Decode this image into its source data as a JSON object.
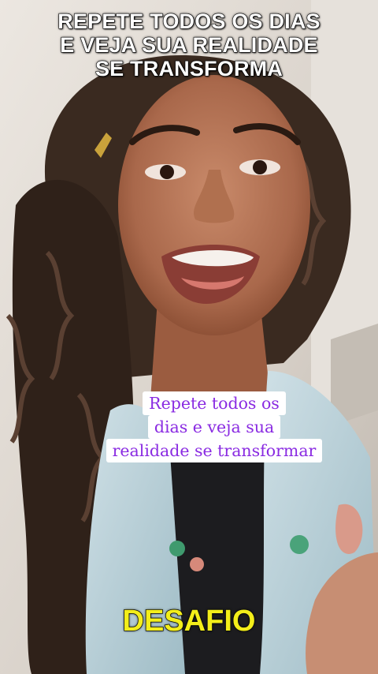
{
  "overlay_top": {
    "lines": [
      "REPETE TODOS OS DIAS",
      "E VEJA SUA REALIDADE",
      "SE TRANSFORMA"
    ]
  },
  "caption": {
    "lines": [
      "Repete todos os",
      "dias e veja sua",
      "realidade se transformar"
    ]
  },
  "bottom_label": "DESAFIO",
  "colors": {
    "caption_text": "#8a2be2",
    "bottom_label": "#f3ee1a",
    "title_text": "#ffffff"
  }
}
